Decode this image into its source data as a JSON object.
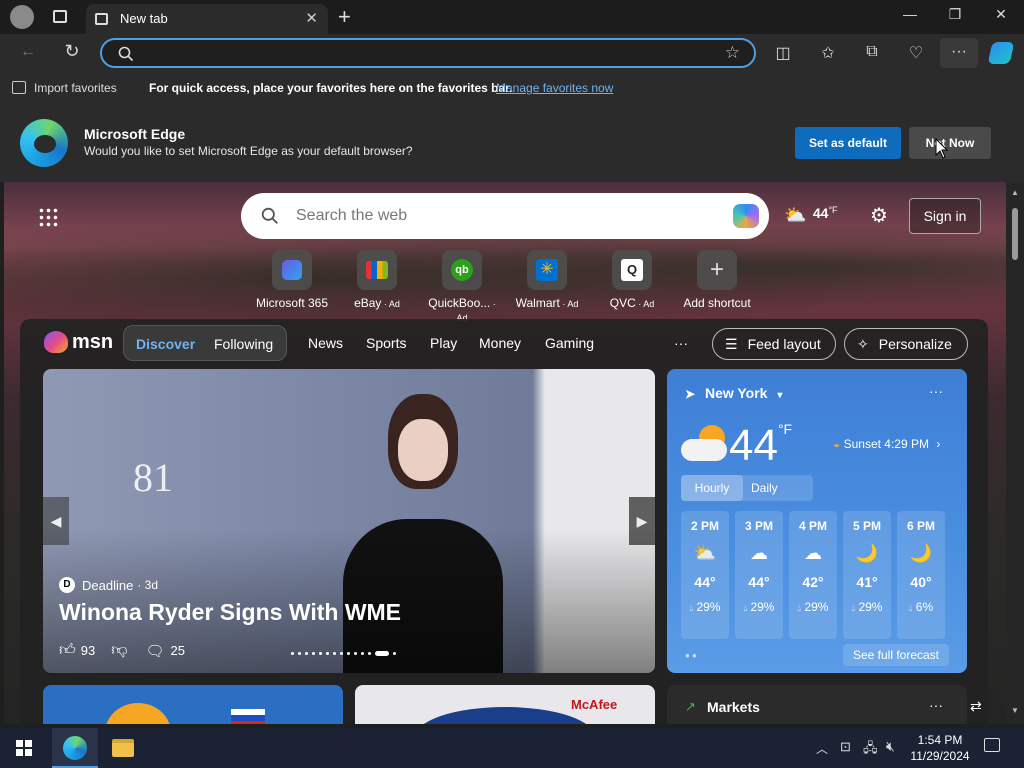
{
  "browser": {
    "tab_title": "New tab",
    "favorites_bar": {
      "import_label": "Import favorites",
      "message": "For quick access, place your favorites here on the favorites bar.",
      "manage_link": "Manage favorites now"
    },
    "default_banner": {
      "title": "Microsoft Edge",
      "message": "Would you like to set Microsoft Edge as your default browser?",
      "set_default_label": "Set as default",
      "not_now_label": "Not Now"
    }
  },
  "newtab": {
    "search_placeholder": "Search the web",
    "weather_temp": "44",
    "weather_unit": "°F",
    "sign_in_label": "Sign in",
    "shortcuts": [
      {
        "label": "Microsoft 365",
        "ad": ""
      },
      {
        "label": "eBay",
        "ad": " · Ad"
      },
      {
        "label": "QuickBoo...",
        "ad": " · Ad"
      },
      {
        "label": "Walmart",
        "ad": " · Ad"
      },
      {
        "label": "QVC",
        "ad": " · Ad"
      },
      {
        "label": "Add shortcut",
        "ad": ""
      }
    ],
    "feed": {
      "brand": "msn",
      "tabs": [
        "Discover",
        "Following"
      ],
      "nav": [
        "News",
        "Sports",
        "Play",
        "Money",
        "Gaming"
      ],
      "more": "···",
      "feed_layout_label": "Feed layout",
      "personalize_label": "Personalize",
      "hero": {
        "source": "Deadline",
        "age": "· 3d",
        "headline": "Winona Ryder Signs With WME",
        "likes": "93",
        "comments": "25"
      },
      "weather_card": {
        "location": "New York",
        "temp": "44",
        "unit": "°F",
        "sunset": "Sunset 4:29 PM",
        "tabs": [
          "Hourly",
          "Daily"
        ],
        "hours": [
          {
            "time": "2 PM",
            "temp": "44°",
            "precip": "29%"
          },
          {
            "time": "3 PM",
            "temp": "44°",
            "precip": "29%"
          },
          {
            "time": "4 PM",
            "temp": "42°",
            "precip": "29%"
          },
          {
            "time": "5 PM",
            "temp": "41°",
            "precip": "29%"
          },
          {
            "time": "6 PM",
            "temp": "40°",
            "precip": "6%"
          }
        ],
        "forecast_link": "See full forecast"
      },
      "mcafee": "McAfee",
      "markets": "Markets"
    }
  },
  "taskbar": {
    "time": "1:54 PM",
    "date": "11/29/2024"
  },
  "colors": {
    "accent": "#0f6cbd",
    "address_border": "#4f9fe6",
    "weather_bg": "#4b8fe0"
  }
}
